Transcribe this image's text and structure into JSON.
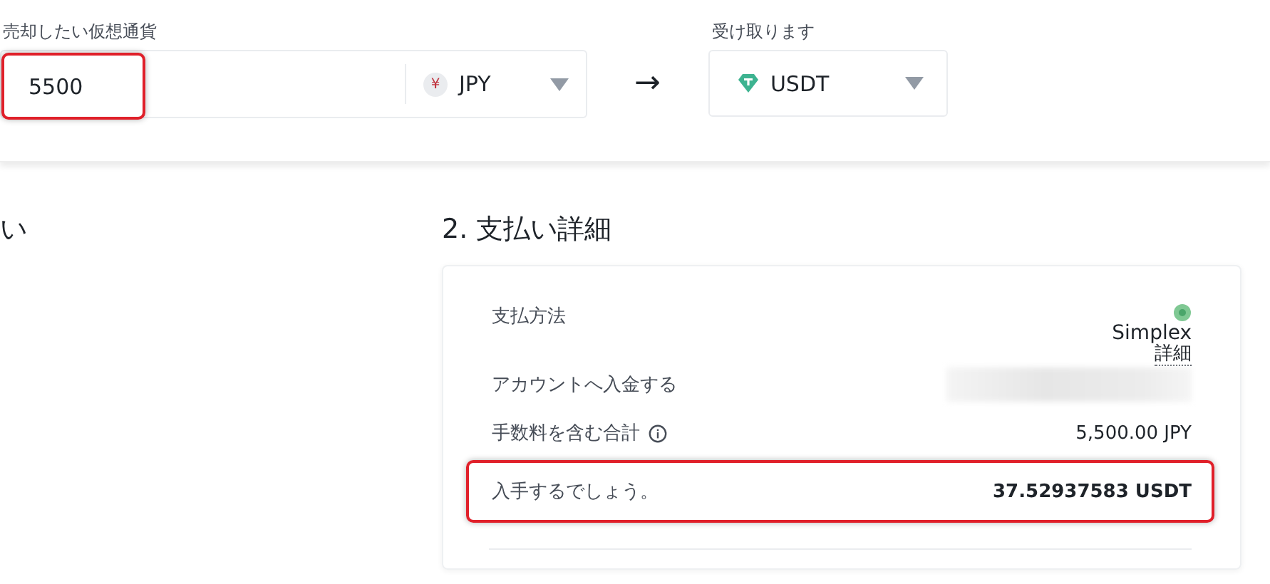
{
  "sell": {
    "label": "売却したい仮想通貨",
    "amount": "5500",
    "highlighted": true,
    "currency": {
      "symbol": "¥",
      "code": "JPY"
    }
  },
  "arrow": "→",
  "receive": {
    "label": "受け取ります",
    "currency": {
      "code": "USDT"
    }
  },
  "left_section": {
    "title_fragment": "い"
  },
  "payment_details": {
    "title": "2. 支払い詳細",
    "rows": [
      {
        "kind": "method",
        "label": "支払方法",
        "value": "Simplex",
        "link": "詳細"
      },
      {
        "kind": "redacted",
        "label": "アカウントへ入金する"
      },
      {
        "kind": "info",
        "label": "手数料を含む合計",
        "value": "5,500.00 JPY",
        "highlighted": false,
        "bold": false
      },
      {
        "kind": "plain",
        "label": "入手するでしょう。",
        "value": "37.52937583 USDT",
        "highlighted": true,
        "bold": true
      }
    ]
  }
}
